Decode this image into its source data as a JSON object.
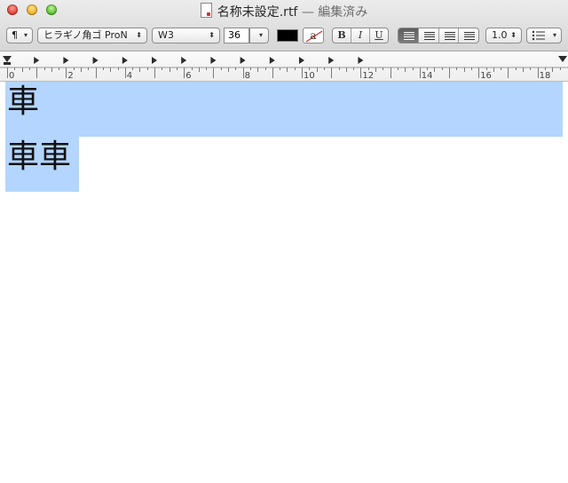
{
  "window": {
    "file_name": "名称未設定.rtf",
    "edited_suffix": "— 編集済み"
  },
  "toolbar": {
    "paragraph_style": "¶",
    "font_family": "ヒラギノ角ゴ ProN",
    "font_weight": "W3",
    "font_size": "36",
    "bold": "B",
    "italic": "I",
    "underline": "U",
    "line_spacing": "1.0",
    "highlight_glyph": "a"
  },
  "ruler": {
    "labels": [
      "0",
      "2",
      "4",
      "6",
      "8",
      "10",
      "12",
      "14",
      "16",
      "18"
    ]
  },
  "document": {
    "lines": [
      "車",
      "車車"
    ]
  },
  "colors": {
    "selection": "#b3d5ff",
    "text_color_well": "#000000"
  }
}
